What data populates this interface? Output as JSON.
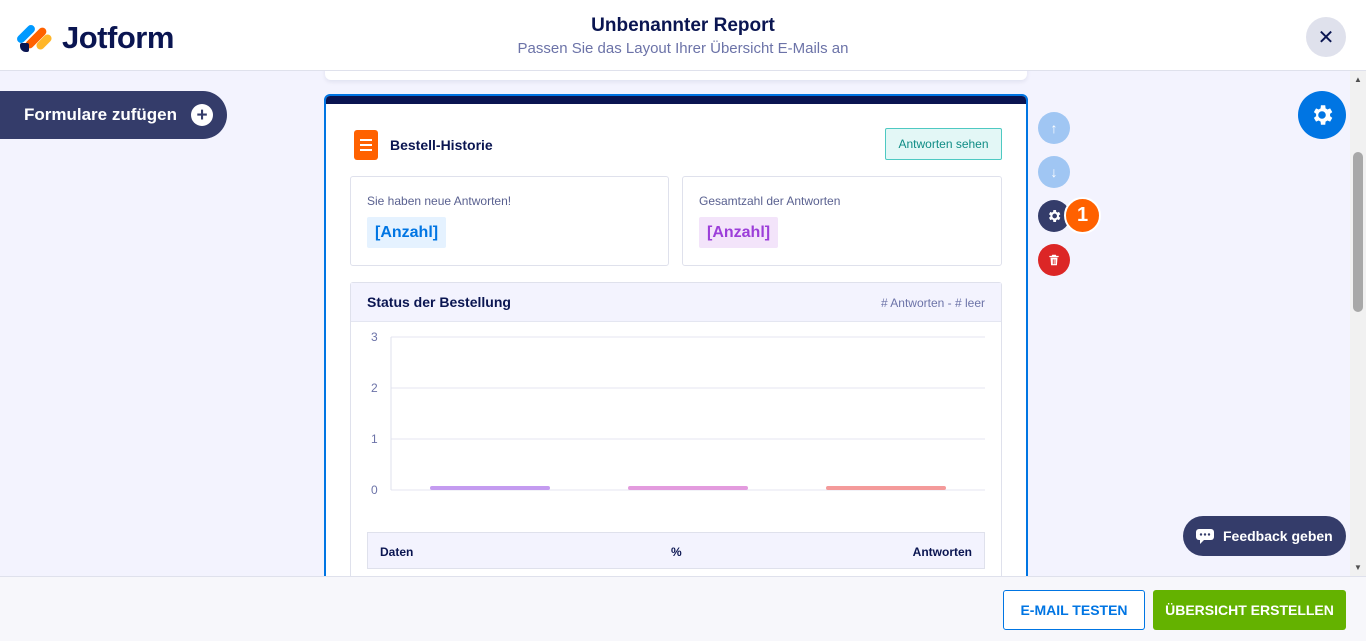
{
  "app": {
    "logo_text": "Jotform",
    "title": "Unbenannter Report",
    "subtitle": "Passen Sie das Layout Ihrer Übersicht E-Mails an",
    "close_icon": "close-icon"
  },
  "sidebar": {
    "add_forms_label": "Formulare zufügen"
  },
  "card": {
    "title": "Bestell-Historie",
    "see_answers_label": "Antworten sehen",
    "stats": [
      {
        "label": "Sie haben neue Antworten!",
        "value": "[Anzahl]",
        "color": "#0075e3"
      },
      {
        "label": "Gesamtzahl der Antworten",
        "value": "[Anzahl]",
        "color": "#9c3ed9"
      }
    ],
    "chart_section": {
      "title": "Status der Bestellung",
      "note": "# Antworten - # leer"
    },
    "table": {
      "headers": [
        "Daten",
        "%",
        "Antworten"
      ]
    }
  },
  "chart_data": {
    "type": "bar",
    "categories": [
      "",
      "",
      ""
    ],
    "values": [
      0,
      0,
      0
    ],
    "colors": [
      "#c49bf0",
      "#e39bde",
      "#f49a9a"
    ],
    "yticks": [
      0,
      1,
      2,
      3
    ],
    "ylim": [
      0,
      3
    ],
    "grid": true,
    "title": "",
    "xlabel": "",
    "ylabel": ""
  },
  "side_actions": {
    "badge_number": "1"
  },
  "feedback": {
    "label": "Feedback geben"
  },
  "footer": {
    "test_label": "E-MAIL TESTEN",
    "create_label": "ÜBERSICHT ERSTELLEN"
  },
  "colors": {
    "primary": "#0075e3",
    "navy": "#0a1551",
    "green": "#64b200",
    "orange": "#ff6100",
    "danger": "#dc2626"
  }
}
